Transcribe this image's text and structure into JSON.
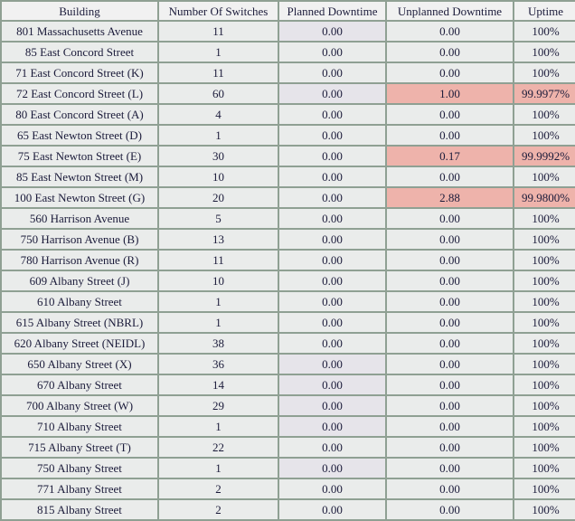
{
  "table": {
    "columns": [
      {
        "key": "building",
        "label": "Building"
      },
      {
        "key": "switches",
        "label": "Number Of Switches"
      },
      {
        "key": "planned",
        "label": "Planned Downtime"
      },
      {
        "key": "unplanned",
        "label": "Unplanned Downtime"
      },
      {
        "key": "uptime",
        "label": "Uptime"
      }
    ],
    "colors": {
      "border": "#8fa093",
      "header_background": "#f1f1f1",
      "cell_background": "#eaeceb",
      "cell_background_tinted": "#e6e4ea",
      "alert_background": "#eeb3ab",
      "text": "#1b1b3a"
    },
    "rows": [
      {
        "building": "801 Massachusetts Avenue",
        "switches": "11",
        "planned": "0.00",
        "unplanned": "0.00",
        "uptime": "100%",
        "planned_tinted": true,
        "alert": false
      },
      {
        "building": "85 East Concord Street",
        "switches": "1",
        "planned": "0.00",
        "unplanned": "0.00",
        "uptime": "100%",
        "planned_tinted": false,
        "alert": false
      },
      {
        "building": "71 East Concord Street (K)",
        "switches": "11",
        "planned": "0.00",
        "unplanned": "0.00",
        "uptime": "100%",
        "planned_tinted": false,
        "alert": false
      },
      {
        "building": "72 East Concord Street (L)",
        "switches": "60",
        "planned": "0.00",
        "unplanned": "1.00",
        "uptime": "99.9977%",
        "planned_tinted": true,
        "alert": true
      },
      {
        "building": "80 East Concord Street (A)",
        "switches": "4",
        "planned": "0.00",
        "unplanned": "0.00",
        "uptime": "100%",
        "planned_tinted": false,
        "alert": false
      },
      {
        "building": "65 East Newton Street (D)",
        "switches": "1",
        "planned": "0.00",
        "unplanned": "0.00",
        "uptime": "100%",
        "planned_tinted": false,
        "alert": false
      },
      {
        "building": "75 East Newton Street (E)",
        "switches": "30",
        "planned": "0.00",
        "unplanned": "0.17",
        "uptime": "99.9992%",
        "planned_tinted": false,
        "alert": true
      },
      {
        "building": "85 East Newton Street (M)",
        "switches": "10",
        "planned": "0.00",
        "unplanned": "0.00",
        "uptime": "100%",
        "planned_tinted": false,
        "alert": false
      },
      {
        "building": "100 East Newton Street (G)",
        "switches": "20",
        "planned": "0.00",
        "unplanned": "2.88",
        "uptime": "99.9800%",
        "planned_tinted": false,
        "alert": true
      },
      {
        "building": "560 Harrison Avenue",
        "switches": "5",
        "planned": "0.00",
        "unplanned": "0.00",
        "uptime": "100%",
        "planned_tinted": false,
        "alert": false
      },
      {
        "building": "750 Harrison Avenue (B)",
        "switches": "13",
        "planned": "0.00",
        "unplanned": "0.00",
        "uptime": "100%",
        "planned_tinted": false,
        "alert": false
      },
      {
        "building": "780 Harrison Avenue (R)",
        "switches": "11",
        "planned": "0.00",
        "unplanned": "0.00",
        "uptime": "100%",
        "planned_tinted": false,
        "alert": false
      },
      {
        "building": "609 Albany Street (J)",
        "switches": "10",
        "planned": "0.00",
        "unplanned": "0.00",
        "uptime": "100%",
        "planned_tinted": false,
        "alert": false
      },
      {
        "building": "610 Albany Street",
        "switches": "1",
        "planned": "0.00",
        "unplanned": "0.00",
        "uptime": "100%",
        "planned_tinted": false,
        "alert": false
      },
      {
        "building": "615 Albany Street (NBRL)",
        "switches": "1",
        "planned": "0.00",
        "unplanned": "0.00",
        "uptime": "100%",
        "planned_tinted": false,
        "alert": false
      },
      {
        "building": "620 Albany Street (NEIDL)",
        "switches": "38",
        "planned": "0.00",
        "unplanned": "0.00",
        "uptime": "100%",
        "planned_tinted": false,
        "alert": false
      },
      {
        "building": "650 Albany Street (X)",
        "switches": "36",
        "planned": "0.00",
        "unplanned": "0.00",
        "uptime": "100%",
        "planned_tinted": true,
        "alert": false
      },
      {
        "building": "670 Albany Street",
        "switches": "14",
        "planned": "0.00",
        "unplanned": "0.00",
        "uptime": "100%",
        "planned_tinted": true,
        "alert": false
      },
      {
        "building": "700 Albany Street (W)",
        "switches": "29",
        "planned": "0.00",
        "unplanned": "0.00",
        "uptime": "100%",
        "planned_tinted": true,
        "alert": false
      },
      {
        "building": "710 Albany Street",
        "switches": "1",
        "planned": "0.00",
        "unplanned": "0.00",
        "uptime": "100%",
        "planned_tinted": true,
        "alert": false
      },
      {
        "building": "715 Albany Street (T)",
        "switches": "22",
        "planned": "0.00",
        "unplanned": "0.00",
        "uptime": "100%",
        "planned_tinted": false,
        "alert": false
      },
      {
        "building": "750 Albany Street",
        "switches": "1",
        "planned": "0.00",
        "unplanned": "0.00",
        "uptime": "100%",
        "planned_tinted": true,
        "alert": false
      },
      {
        "building": "771 Albany Street",
        "switches": "2",
        "planned": "0.00",
        "unplanned": "0.00",
        "uptime": "100%",
        "planned_tinted": false,
        "alert": false
      },
      {
        "building": "815 Albany Street",
        "switches": "2",
        "planned": "0.00",
        "unplanned": "0.00",
        "uptime": "100%",
        "planned_tinted": false,
        "alert": false
      }
    ]
  }
}
